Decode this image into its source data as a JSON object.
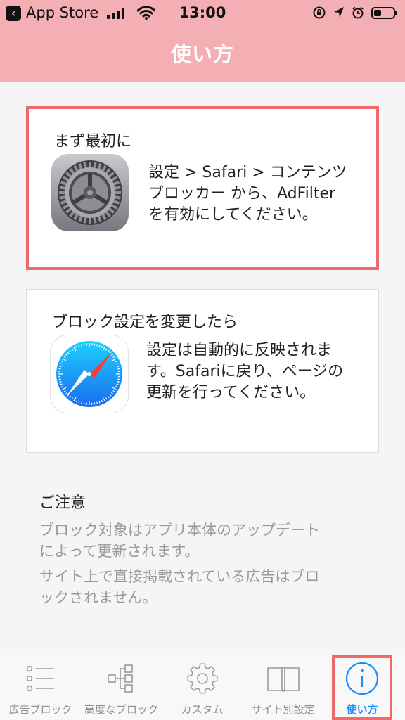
{
  "status_bar": {
    "carrier": "App Store",
    "time": "13:00",
    "battery_level": 0.4
  },
  "nav": {
    "title": "使い方"
  },
  "cards": [
    {
      "title": "まず最初に",
      "icon": "settings-gear-icon",
      "lines": [
        "設定 > Safari > コンテンツ",
        "ブロッカー から、AdFilter",
        "を有効にしてください。"
      ],
      "highlighted": true
    },
    {
      "title": "ブロック設定を変更したら",
      "icon": "safari-compass-icon",
      "lines": [
        "設定は自動的に反映されま",
        "す。Safariに戻り、ページの",
        "更新を行ってください。"
      ],
      "highlighted": false
    }
  ],
  "notes": {
    "title": "ご注意",
    "items": [
      [
        "ブロック対象はアプリ本体のアップデート",
        "によって更新されます。"
      ],
      [
        "サイト上で直接掲載されている広告はブロ",
        "ックされません。"
      ]
    ]
  },
  "tabs": [
    {
      "label": "広告ブロック",
      "icon": "list-icon",
      "active": false
    },
    {
      "label": "高度なブロック",
      "icon": "hierarchy-icon",
      "active": false
    },
    {
      "label": "カスタム",
      "icon": "gear-icon",
      "active": false
    },
    {
      "label": "サイト別設定",
      "icon": "book-icon",
      "active": false
    },
    {
      "label": "使い方",
      "icon": "info-icon",
      "active": true
    }
  ],
  "colors": {
    "header": "#f3afb4",
    "highlight": "#ef6b6b",
    "tab_active": "#1a8cff",
    "tab_inactive": "#8e8e93"
  }
}
